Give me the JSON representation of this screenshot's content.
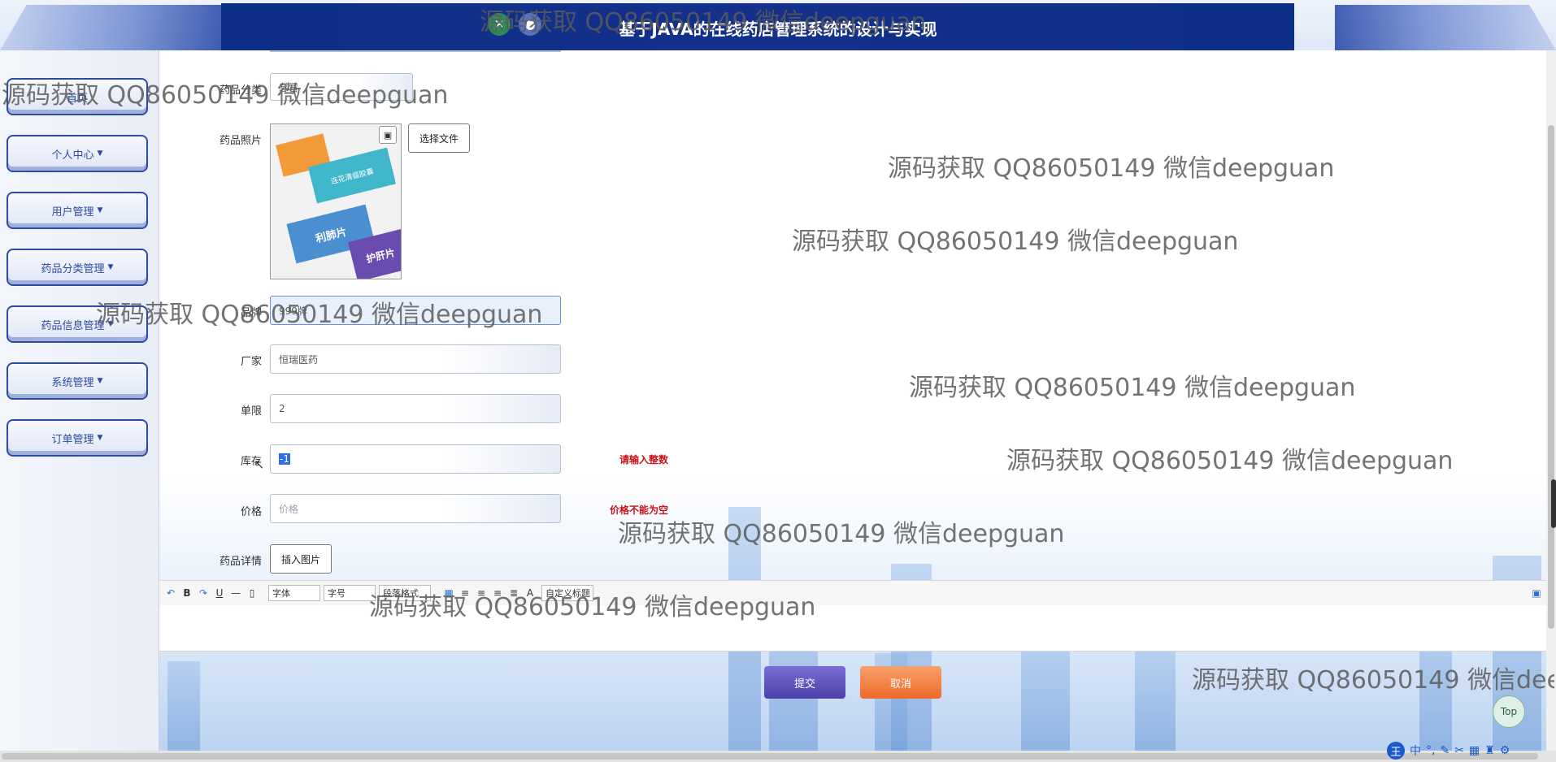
{
  "header": {
    "title": "基于JAVA的在线药店管理系统的设计与实现"
  },
  "sidebar": {
    "items": [
      {
        "label": "首页"
      },
      {
        "label": "个人中心"
      },
      {
        "label": "用户管理"
      },
      {
        "label": "药品分类管理"
      },
      {
        "label": "药品信息管理"
      },
      {
        "label": "系统管理"
      },
      {
        "label": "订单管理"
      }
    ]
  },
  "form": {
    "category_label": "药品分类",
    "category_value": "感冒",
    "photo_label": "药品照片",
    "photo_product_text": [
      "连花清瘟胶囊",
      "利肺片",
      "护肝片"
    ],
    "choose_file_label": "选择文件",
    "brand_label": "品牌",
    "brand_value": "999牌",
    "manufacturer_label": "厂家",
    "manufacturer_value": "恒瑞医药",
    "limit_label": "单限",
    "limit_value": "2",
    "stock_label": "库存",
    "stock_value": "-1",
    "stock_error": "请输入整数",
    "price_label": "价格",
    "price_placeholder": "价格",
    "price_error": "价格不能为空",
    "detail_label": "药品详情",
    "insert_image_label": "插入图片"
  },
  "editor": {
    "font_select": "字体",
    "size_select": "字号",
    "paragraph_select": "段落格式",
    "custom_title_select": "自定义标题"
  },
  "actions": {
    "submit_label": "提交",
    "cancel_label": "取消"
  },
  "top_button": "Top",
  "ime": {
    "logo": "王",
    "mode": "中"
  },
  "watermark": "源码获取 QQ86050149 微信deepguan",
  "colors": {
    "header": "#0d2f88",
    "submit": "#5b4fb8",
    "cancel": "#f07a3a",
    "error": "#c8141a"
  }
}
